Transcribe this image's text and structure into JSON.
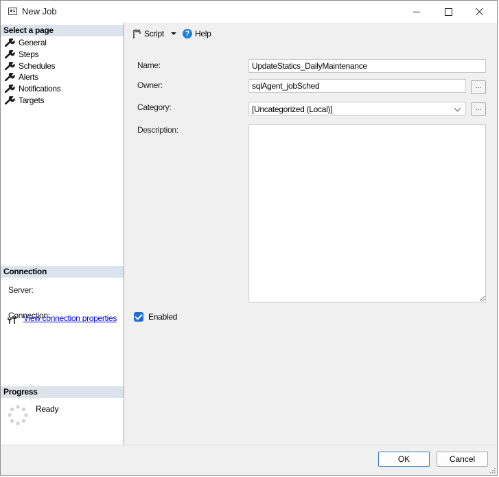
{
  "window": {
    "title": "New Job"
  },
  "left_pane": {
    "select_page_header": "Select a page",
    "pages": [
      {
        "label": "General"
      },
      {
        "label": "Steps"
      },
      {
        "label": "Schedules"
      },
      {
        "label": "Alerts"
      },
      {
        "label": "Notifications"
      },
      {
        "label": "Targets"
      }
    ],
    "connection": {
      "header": "Connection",
      "server_label": "Server:",
      "connection_label": "Connection:",
      "view_properties_link": "View connection properties"
    },
    "progress": {
      "header": "Progress",
      "status": "Ready"
    }
  },
  "toolbar": {
    "script_label": "Script",
    "help_label": "Help"
  },
  "form": {
    "name_label": "Name:",
    "name_value": "UpdateStatics_DailyMaintenance",
    "owner_label": "Owner:",
    "owner_value": "sqlAgent_jobSched",
    "category_label": "Category:",
    "category_value": "[Uncategorized (Local)]",
    "description_label": "Description:",
    "description_value": "",
    "browse_label": "...",
    "enabled_label": "Enabled",
    "enabled_checked": true
  },
  "buttons": {
    "ok_label": "OK",
    "cancel_label": "Cancel"
  },
  "colors": {
    "section_header_bg": "#dde3ed",
    "checkbox_accent": "#1f6fcf",
    "link": "#0000ee"
  }
}
